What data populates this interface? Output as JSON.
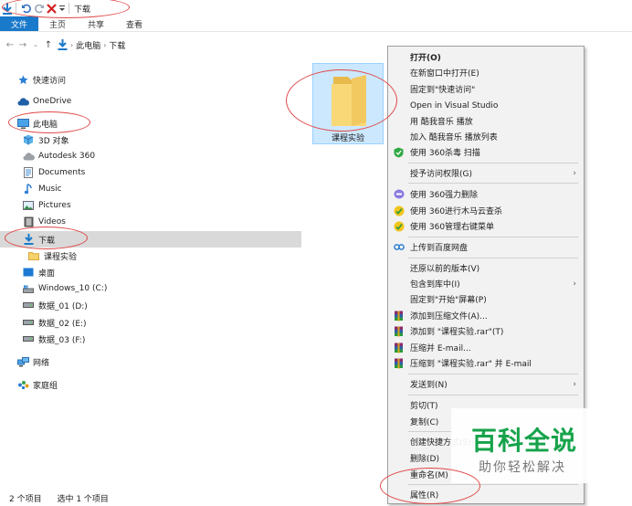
{
  "window": {
    "title": "下载"
  },
  "ribbon": {
    "tabs": [
      "文件",
      "主页",
      "共享",
      "查看"
    ]
  },
  "address": {
    "crumbs": [
      "此电脑",
      "下载"
    ]
  },
  "sidebar": {
    "items": [
      {
        "label": "快速访问",
        "icon": "star-icon"
      },
      {
        "label": "OneDrive",
        "icon": "cloud-icon"
      },
      {
        "label": "此电脑",
        "icon": "computer-icon"
      },
      {
        "label": "3D 对象",
        "icon": "cube-icon"
      },
      {
        "label": "Autodesk 360",
        "icon": "autodesk-icon"
      },
      {
        "label": "Documents",
        "icon": "document-icon"
      },
      {
        "label": "Music",
        "icon": "music-icon"
      },
      {
        "label": "Pictures",
        "icon": "pictures-icon"
      },
      {
        "label": "Videos",
        "icon": "video-icon"
      },
      {
        "label": "下载",
        "icon": "download-icon"
      },
      {
        "label": "课程实验",
        "icon": "folder-icon"
      },
      {
        "label": "桌面",
        "icon": "desktop-icon"
      },
      {
        "label": "Windows_10 (C:)",
        "icon": "drive-windows-icon"
      },
      {
        "label": "数据_01 (D:)",
        "icon": "drive-icon"
      },
      {
        "label": "数据_02 (E:)",
        "icon": "drive-icon"
      },
      {
        "label": "数据_03 (F:)",
        "icon": "drive-icon"
      },
      {
        "label": "网络",
        "icon": "network-icon"
      },
      {
        "label": "家庭组",
        "icon": "homegroup-icon"
      }
    ]
  },
  "content": {
    "folder_label": "课程实验"
  },
  "status": {
    "count": "2 个项目",
    "selected": "选中 1 个项目"
  },
  "menu": {
    "items": [
      {
        "label": "打开(O)"
      },
      {
        "label": "在新窗口中打开(E)"
      },
      {
        "label": "固定到\"快速访问\""
      },
      {
        "label": "Open in Visual Studio"
      },
      {
        "label": "用 酷我音乐 播放"
      },
      {
        "label": "加入 酷我音乐 播放列表"
      },
      {
        "label": "使用 360杀毒 扫描"
      },
      {
        "label": "授予访问权限(G)"
      },
      {
        "label": "使用 360强力删除"
      },
      {
        "label": "使用 360进行木马云查杀"
      },
      {
        "label": "使用 360管理右键菜单"
      },
      {
        "label": "上传到百度网盘"
      },
      {
        "label": "还原以前的版本(V)"
      },
      {
        "label": "包含到库中(I)"
      },
      {
        "label": "固定到\"开始\"屏幕(P)"
      },
      {
        "label": "添加到压缩文件(A)..."
      },
      {
        "label": "添加到 \"课程实验.rar\"(T)"
      },
      {
        "label": "压缩并 E-mail..."
      },
      {
        "label": "压缩到 \"课程实验.rar\" 并 E-mail"
      },
      {
        "label": "发送到(N)"
      },
      {
        "label": "剪切(T)"
      },
      {
        "label": "复制(C)"
      },
      {
        "label": "创建快捷方式(S)"
      },
      {
        "label": "删除(D)"
      },
      {
        "label": "重命名(M)"
      },
      {
        "label": "属性(R)"
      }
    ]
  },
  "watermark": {
    "main": "百科全说",
    "sub": "助你轻松解决"
  },
  "colors": {
    "accent": "#1979ca",
    "selection": "#cce8ff",
    "annotation": "#e04848",
    "watermark": "#16a34a"
  }
}
